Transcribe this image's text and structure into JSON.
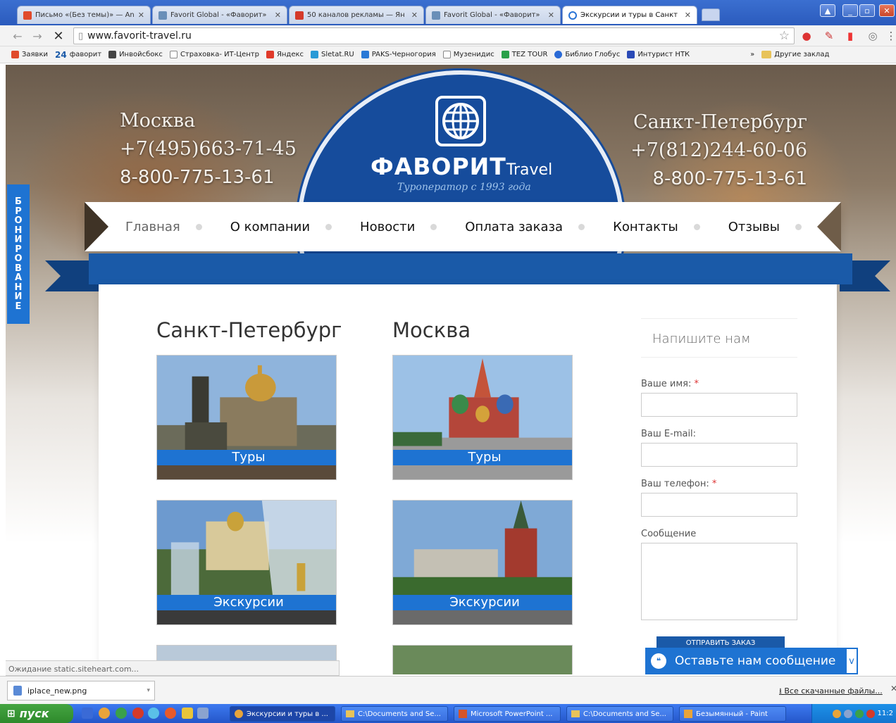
{
  "browser": {
    "tabs": [
      {
        "label": "Письмо «(Без темы)» — An",
        "color": "#e04a2b"
      },
      {
        "label": "Favorit Global - «Фаворит»",
        "color": "#6a8fb8"
      },
      {
        "label": "50 каналов рекламы — Ян",
        "color": "#d43a2a"
      },
      {
        "label": "Favorit Global - «Фаворит»",
        "color": "#6a8fb8"
      },
      {
        "label": "Экскурсии и туры в Санкт",
        "color": "#2a74d6"
      }
    ],
    "url": "www.favorit-travel.ru",
    "bookmarks": [
      {
        "label": "Заявки",
        "color": "#e04a2b"
      },
      {
        "label": "фаворит",
        "prefix": "24"
      },
      {
        "label": "Инвойсбокс",
        "color": "#444"
      },
      {
        "label": "Страховка- ИТ-Центр",
        "color": "#888"
      },
      {
        "label": "Яндекс",
        "color": "#e03a2a"
      },
      {
        "label": "Sletat.RU",
        "color": "#2a9ad6"
      },
      {
        "label": "PAKS-Черногория",
        "color": "#2a7ad6"
      },
      {
        "label": "Музенидис",
        "color": "#888"
      },
      {
        "label": "TEZ TOUR",
        "color": "#2aa04a"
      },
      {
        "label": "Библио Глобус",
        "color": "#2a6ad6"
      },
      {
        "label": "Интурист НТК",
        "color": "#2a4ab6"
      }
    ],
    "bookmarks_more": "»",
    "other_bookmarks": "Другие заклад"
  },
  "site": {
    "moscow": {
      "city": "Москва",
      "phone1": "+7(495)663-71-45",
      "phone2": "8-800-775-13-61"
    },
    "spb": {
      "city": "Санкт-Петербург",
      "phone1": "+7(812)244-60-06",
      "phone2": "8-800-775-13-61"
    },
    "logo": {
      "name": "ФАВОРИТ",
      "suffix": "Travel",
      "tagline": "Туроператор с 1993 года"
    },
    "menu": [
      "Главная",
      "О компании",
      "Новости",
      "Оплата заказа",
      "Контакты",
      "Отзывы"
    ],
    "booking_tab": [
      "Б",
      "Р",
      "О",
      "Н",
      "И",
      "Р",
      "О",
      "В",
      "А",
      "Н",
      "И",
      "Е"
    ],
    "columns": [
      {
        "title": "Санкт-Петербург",
        "cards": [
          "Туры",
          "Экскурсии"
        ]
      },
      {
        "title": "Москва",
        "cards": [
          "Туры",
          "Экскурсии"
        ]
      }
    ],
    "form": {
      "title": "Напишите нам",
      "name_label": "Ваше имя:",
      "email_label": "Ваш E-mail:",
      "phone_label": "Ваш телефон:",
      "message_label": "Сообщение",
      "required_mark": "*",
      "submit": "ОТПРАВИТЬ ЗАКАЗ"
    },
    "chat_widget": "Оставьте нам сообщение",
    "chat_toggle": "v"
  },
  "status_text": "Ожидание static.siteheart.com...",
  "download": {
    "file": "iplace_new.png",
    "all": "Все скачанные файлы..."
  },
  "taskbar": {
    "start": "пуск",
    "tasks": [
      "Экскурсии и туры в ...",
      "C:\\Documents and Se...",
      "Microsoft PowerPoint ...",
      "C:\\Documents and Se...",
      "Безымянный - Paint"
    ],
    "clock": "11:2"
  },
  "colors": {
    "brand_blue": "#164c9c",
    "accent_blue": "#1e73d2"
  }
}
